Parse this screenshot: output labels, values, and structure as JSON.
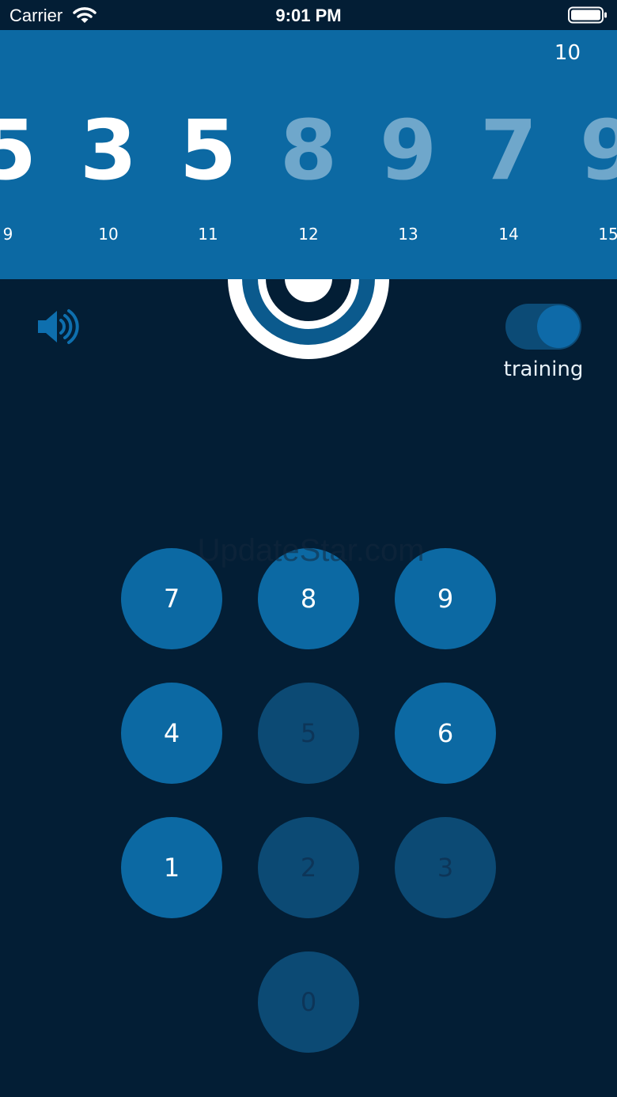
{
  "status_bar": {
    "carrier": "Carrier",
    "time": "9:01 PM"
  },
  "banner": {
    "counter": "10",
    "digits": [
      {
        "value": "5",
        "index": "9",
        "faded": false
      },
      {
        "value": "3",
        "index": "10",
        "faded": false
      },
      {
        "value": "5",
        "index": "11",
        "faded": false
      },
      {
        "value": "8",
        "index": "12",
        "faded": true
      },
      {
        "value": "9",
        "index": "13",
        "faded": true
      },
      {
        "value": "7",
        "index": "14",
        "faded": true
      },
      {
        "value": "9",
        "index": "15",
        "faded": true
      }
    ]
  },
  "toggle": {
    "label": "training",
    "on": true
  },
  "watermark": "UpdateStar.com",
  "keypad": {
    "keys": [
      {
        "label": "7",
        "enabled": true
      },
      {
        "label": "8",
        "enabled": true
      },
      {
        "label": "9",
        "enabled": true
      },
      {
        "label": "4",
        "enabled": true
      },
      {
        "label": "5",
        "enabled": false
      },
      {
        "label": "6",
        "enabled": true
      },
      {
        "label": "1",
        "enabled": true
      },
      {
        "label": "2",
        "enabled": false
      },
      {
        "label": "3",
        "enabled": false
      },
      {
        "label": "0",
        "enabled": false
      }
    ]
  },
  "colors": {
    "background": "#031e35",
    "banner": "#0c69a3",
    "key_enabled": "#0c69a3",
    "key_disabled": "#0c4a74",
    "faded_digit": "#6fa7cb"
  },
  "icons": {
    "sound": "speaker-icon",
    "wifi": "wifi-icon",
    "battery": "battery-icon"
  }
}
